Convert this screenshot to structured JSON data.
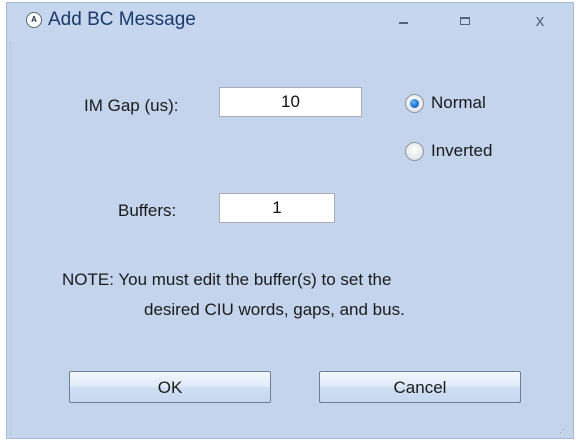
{
  "window": {
    "title": "Add BC Message",
    "icon_text": "A",
    "icons": {
      "app": "app-logo-icon",
      "minimize": "minimize-icon",
      "maximize": "maximize-icon",
      "close": "close-icon"
    },
    "close_glyph": "x"
  },
  "form": {
    "im_gap_label": "IM Gap (us):",
    "im_gap_value": "10",
    "buffers_label": "Buffers:",
    "buffers_value": "1",
    "polarity": {
      "options": [
        {
          "label": "Normal",
          "selected": true
        },
        {
          "label": "Inverted",
          "selected": false
        }
      ]
    }
  },
  "note": {
    "line1": "NOTE: You must edit the buffer(s) to set the",
    "line2": "desired CIU words, gaps, and bus."
  },
  "buttons": {
    "ok": "OK",
    "cancel": "Cancel"
  },
  "colors": {
    "window_bg": "#c3d4ec",
    "title_text": "#1b3a6b",
    "radio_selected": "#1a6fd0"
  }
}
